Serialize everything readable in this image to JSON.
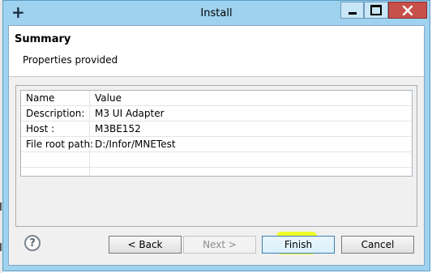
{
  "window": {
    "title": "Install",
    "app_icon": "+",
    "controls": {
      "minimize": "minimize",
      "maximize": "maximize",
      "close": "X"
    }
  },
  "header": {
    "title": "Summary",
    "subtitle": "Properties provided"
  },
  "table": {
    "columns": [
      "Name",
      "Value"
    ],
    "rows": [
      {
        "name": "Description:",
        "value": "M3 UI Adapter"
      },
      {
        "name": "Host :",
        "value": "M3BE152"
      },
      {
        "name": "File root path:",
        "value": "D:/Infor/MNETest"
      }
    ]
  },
  "buttons": {
    "help": "?",
    "back": "< Back",
    "next": "Next >",
    "finish": "Finish",
    "cancel": "Cancel"
  },
  "colors": {
    "frame": "#9fd2ee",
    "close": "#c7504a",
    "highlight": "#f0ff00"
  }
}
